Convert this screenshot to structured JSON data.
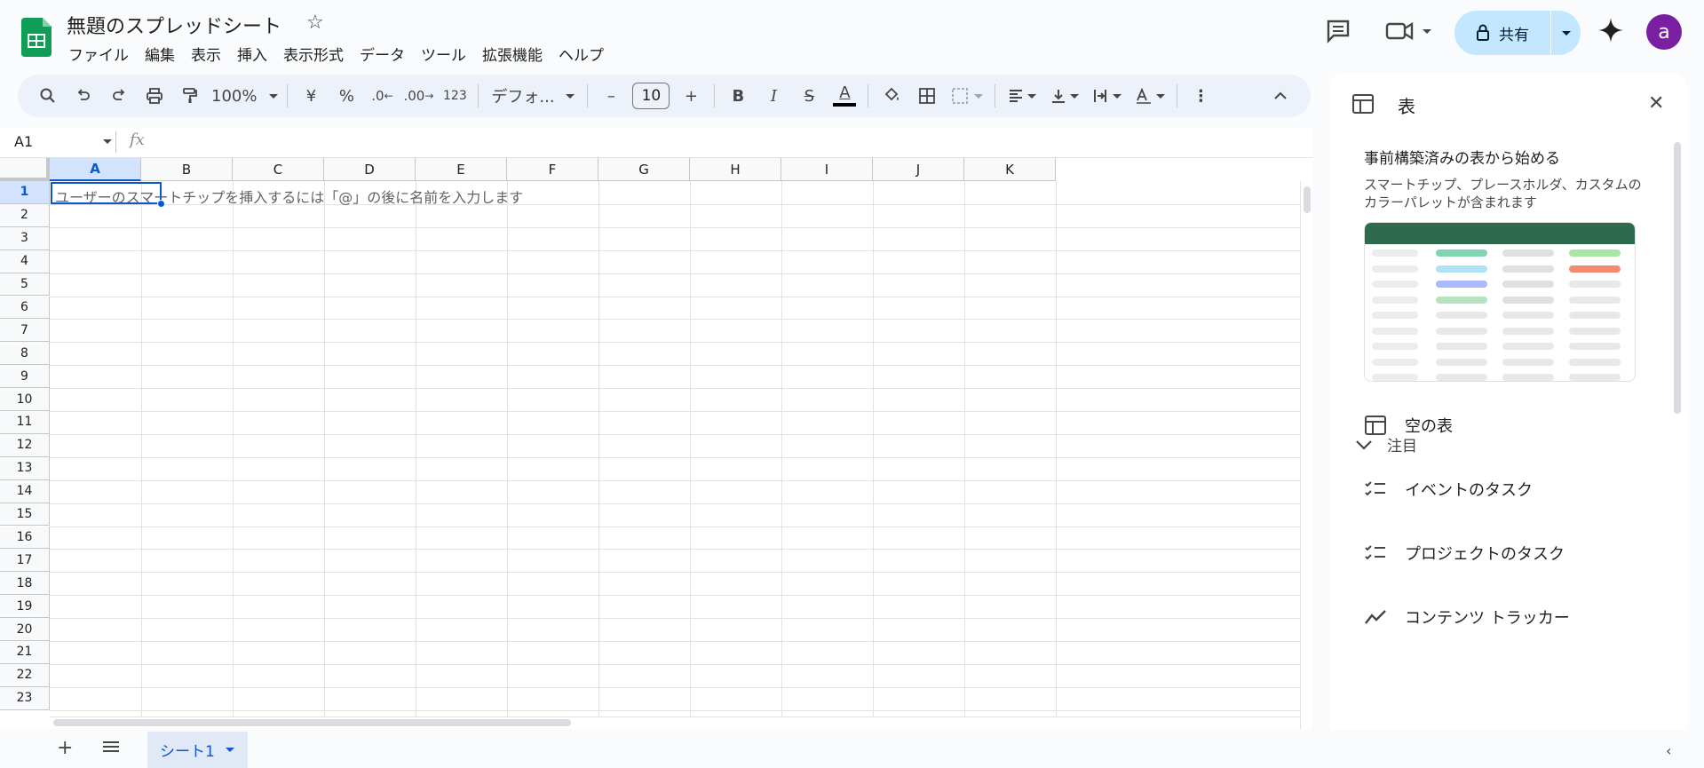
{
  "app": {
    "doc_title": "無題のスプレッドシート",
    "menu": [
      "ファイル",
      "編集",
      "表示",
      "挿入",
      "表示形式",
      "データ",
      "ツール",
      "拡張機能",
      "ヘルプ"
    ],
    "share_label": "共有",
    "avatar_initial": "a",
    "colors": {
      "brand_green": "#0f9d58",
      "share_bg": "#c2e7ff",
      "selection": "#0b57d0",
      "avatar": "#7b1fa2"
    }
  },
  "toolbar": {
    "zoom": "100%",
    "currency": "¥",
    "percent": "%",
    "dec_decrease": ".0",
    "dec_increase": ".00",
    "format_number": "123",
    "font": "デフォ...",
    "font_size": "10",
    "minus": "–",
    "plus": "+",
    "bold": "B",
    "italic": "I",
    "strike": "S",
    "text_color": "A",
    "more": "⋮"
  },
  "formula_bar": {
    "name_box": "A1",
    "fx": "fx"
  },
  "grid": {
    "columns": [
      "A",
      "B",
      "C",
      "D",
      "E",
      "F",
      "G",
      "H",
      "I",
      "J",
      "K"
    ],
    "rows": [
      "1",
      "2",
      "3",
      "4",
      "5",
      "6",
      "7",
      "8",
      "9",
      "10",
      "11",
      "12",
      "13",
      "14",
      "15",
      "16",
      "17",
      "18",
      "19",
      "20",
      "21",
      "22",
      "23"
    ],
    "selected_cell": "A1",
    "hint_text": "ユーザーのスマートチップを挿入するには「@」の後に名前を入力します"
  },
  "sheets": {
    "tabs": [
      "シート1"
    ]
  },
  "side_panel": {
    "title": "表",
    "heading": "事前構築済みの表から始める",
    "description": "スマートチップ、プレースホルダ、カスタムのカラーパレットが含まれます",
    "section": "注目",
    "items": [
      {
        "label": "空の表",
        "icon": "table-icon"
      },
      {
        "label": "イベントのタスク",
        "icon": "checklist-icon"
      },
      {
        "label": "プロジェクトのタスク",
        "icon": "checklist-icon"
      },
      {
        "label": "コンテンツ トラッカー",
        "icon": "trend-icon"
      }
    ]
  }
}
